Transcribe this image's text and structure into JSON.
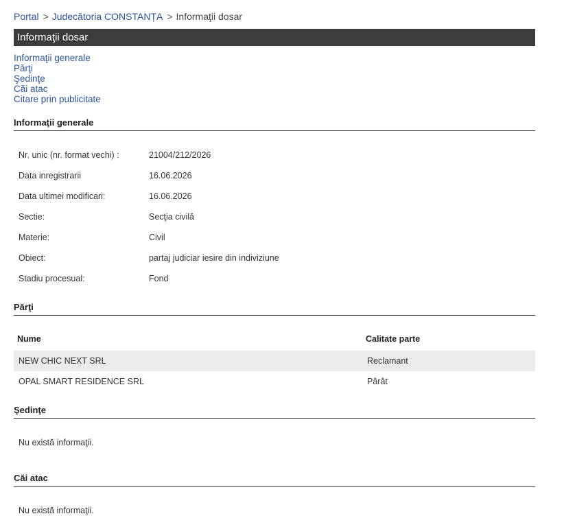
{
  "breadcrumb": {
    "portal": "Portal",
    "separator": ">",
    "court": "Judecătoria CONSTANȚA",
    "current": "Informaţii dosar"
  },
  "title_bar": "Informaţii dosar",
  "nav": {
    "general": "Informaţii generale",
    "parti": "Părţi",
    "sedinte": "Şedinţe",
    "cai_atac": "Căi atac",
    "citare": "Citare prin publicitate"
  },
  "general": {
    "heading": "Informaţii generale",
    "rows": [
      {
        "label": "Nr. unic (nr. format vechi) :",
        "value": "21004/212/2026"
      },
      {
        "label": "Data inregistrarii",
        "value": "16.06.2026"
      },
      {
        "label": "Data ultimei modificari:",
        "value": "16.06.2026"
      },
      {
        "label": "Sectie:",
        "value": "Secţia civilă"
      },
      {
        "label": "Materie:",
        "value": "Civil"
      },
      {
        "label": "Obiect:",
        "value": "partaj judiciar iesire din indiviziune"
      },
      {
        "label": "Stadiu procesual:",
        "value": "Fond"
      }
    ]
  },
  "parti": {
    "heading": "Părţi",
    "columns": [
      "Nume",
      "Calitate parte"
    ],
    "rows": [
      {
        "nume": "NEW CHIC NEXT SRL",
        "calitate": "Reclamant"
      },
      {
        "nume": "OPAL SMART RESIDENCE SRL",
        "calitate": "Pârât"
      }
    ]
  },
  "sedinte": {
    "heading": "Şedinţe",
    "message": "Nu există informaţii."
  },
  "cai_atac": {
    "heading": "Căi atac",
    "message": "Nu există informaţii."
  }
}
